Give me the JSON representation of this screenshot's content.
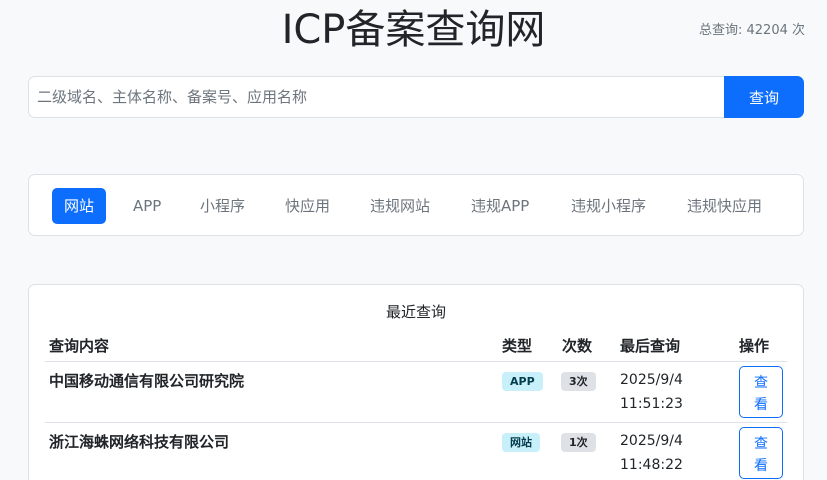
{
  "header": {
    "title": "ICP备案查询网",
    "total_label": "总查询: 42204 次"
  },
  "search": {
    "placeholder": "二级域名、主体名称、备案号、应用名称",
    "button_label": "查询"
  },
  "tabs": [
    {
      "label": "网站",
      "active": true
    },
    {
      "label": "APP",
      "active": false
    },
    {
      "label": "小程序",
      "active": false
    },
    {
      "label": "快应用",
      "active": false
    },
    {
      "label": "违规网站",
      "active": false
    },
    {
      "label": "违规APP",
      "active": false
    },
    {
      "label": "违规小程序",
      "active": false
    },
    {
      "label": "违规快应用",
      "active": false
    }
  ],
  "recent": {
    "title": "最近查询",
    "columns": {
      "content": "查询内容",
      "type": "类型",
      "count": "次数",
      "last": "最后查询",
      "action": "操作"
    },
    "rows": [
      {
        "name": "中国移动通信有限公司研究院",
        "type": "APP",
        "count": "3次",
        "date": "2025/9/4",
        "time": "11:51:23",
        "action": "查看"
      },
      {
        "name": "浙江海蛛网络科技有限公司",
        "type": "网站",
        "count": "1次",
        "date": "2025/9/4",
        "time": "11:48:22",
        "action": "查看"
      }
    ]
  },
  "colors": {
    "accent": "#0d6efd",
    "type_badge_bg": "#c8f0fb",
    "count_badge_bg": "#dee2e6"
  }
}
